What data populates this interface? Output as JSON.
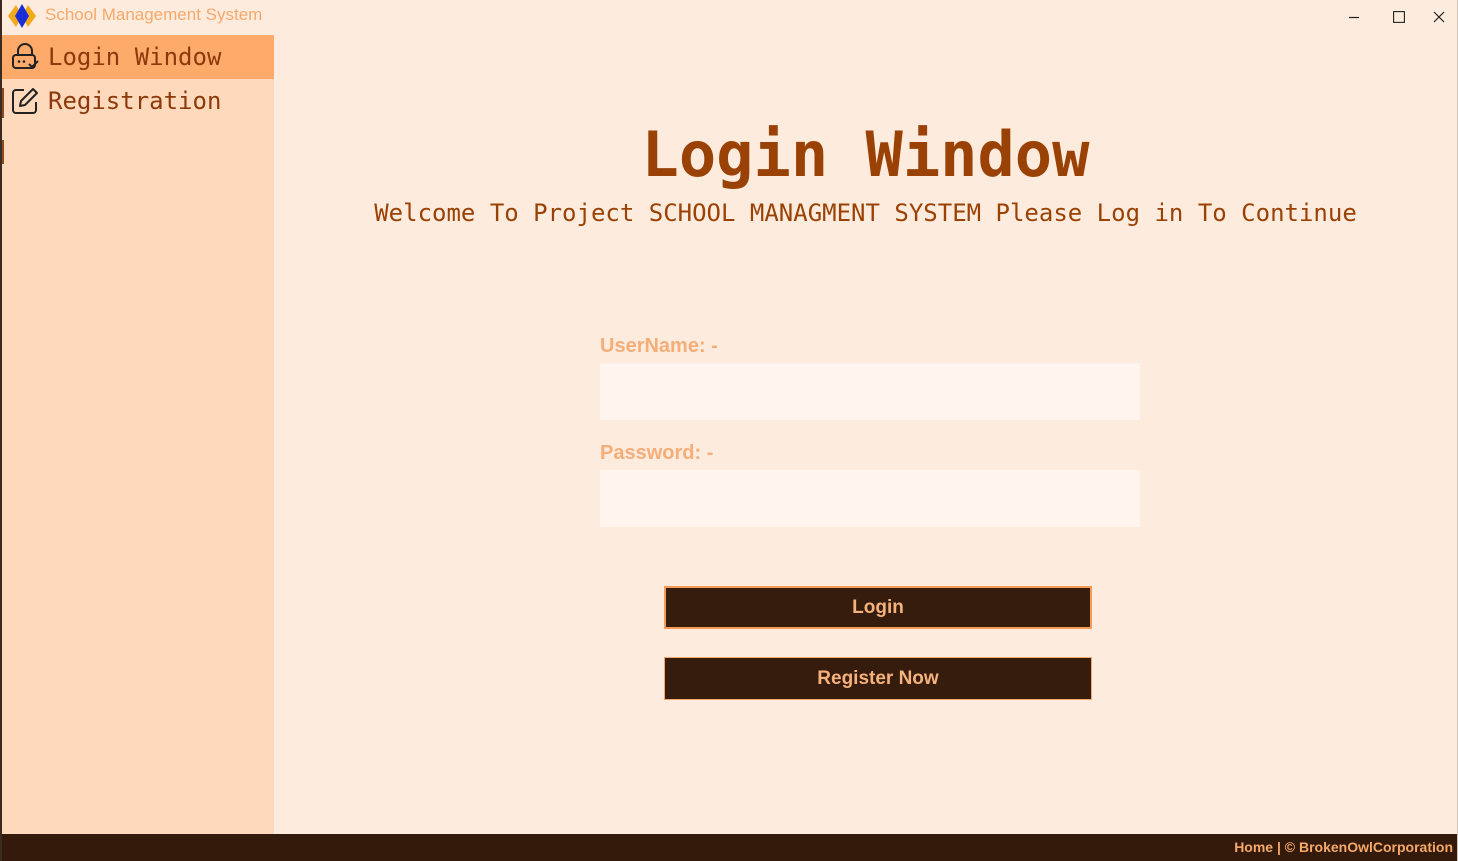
{
  "window": {
    "title": "School Management System",
    "controls": {
      "minimize": "minimize",
      "maximize": "maximize",
      "close": "close"
    }
  },
  "sidebar": {
    "items": [
      {
        "label": "Login Window",
        "icon": "lock-check-icon",
        "active": true
      },
      {
        "label": "Registration",
        "icon": "edit-icon",
        "active": false
      }
    ]
  },
  "main": {
    "title": "Login Window",
    "welcome": "Welcome To Project SCHOOL MANAGMENT SYSTEM Please Log in To Continue",
    "username": {
      "label": "UserName: -",
      "value": "",
      "placeholder": ""
    },
    "password": {
      "label": "Password: -",
      "value": "",
      "placeholder": ""
    },
    "login_button": "Login",
    "register_button": "Register Now"
  },
  "footer": {
    "text": "Home | © BrokenOwlCorporation"
  },
  "colors": {
    "background": "#fdebdd",
    "sidebar": "#ffd9bb",
    "sidebar_active": "#fdaa6b",
    "heading": "#9a4205",
    "label": "#f4ae79",
    "button_bg": "#361c0c",
    "button_text": "#f6b27c",
    "footer_bg": "#331a0a"
  }
}
